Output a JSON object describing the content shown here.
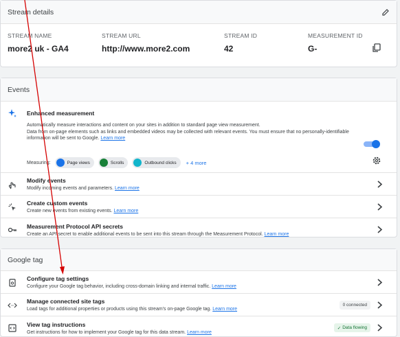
{
  "stream_details": {
    "header": "Stream details",
    "fields": [
      {
        "label": "STREAM NAME",
        "value": "more2 uk - GA4"
      },
      {
        "label": "STREAM URL",
        "value": "http://www.more2.com"
      },
      {
        "label": "STREAM ID",
        "value": "42"
      },
      {
        "label": "MEASUREMENT ID",
        "value": "G-"
      }
    ]
  },
  "events": {
    "header": "Events",
    "enhanced": {
      "title": "Enhanced measurement",
      "desc": "Automatically measure interactions and content on your sites in addition to standard page view measurement.",
      "desc2": "Data from on-page elements such as links and embedded videos may be collected with relevant events. You must ensure that no personally-identifiable information will be sent to Google.",
      "learn_more": "Learn more",
      "measuring_label": "Measuring:",
      "chips": [
        "Page views",
        "Scrolls",
        "Outbound clicks"
      ],
      "more": "+ 4 more",
      "enabled": true
    },
    "rows": [
      {
        "title": "Modify events",
        "desc": "Modify incoming events and parameters.",
        "link": "Learn more"
      },
      {
        "title": "Create custom events",
        "desc": "Create new events from existing events.",
        "link": "Learn more"
      },
      {
        "title": "Measurement Protocol API secrets",
        "desc": "Create an API secret to enable additional events to be sent into this stream through the Measurement Protocol.",
        "link": "Learn more"
      }
    ]
  },
  "google_tag": {
    "header": "Google tag",
    "rows": [
      {
        "title": "Configure tag settings",
        "desc": "Configure your Google tag behavior, including cross-domain linking and internal traffic.",
        "link": "Learn more"
      },
      {
        "title": "Manage connected site tags",
        "desc": "Load tags for additional properties or products using this stream's on-page Google tag.",
        "link": "Learn more",
        "badge": "0 connected"
      },
      {
        "title": "View tag instructions",
        "desc": "Get instructions for how to implement your Google tag for this data stream.",
        "link": "Learn more",
        "badge": "Data flowing"
      }
    ]
  },
  "colors": {
    "accent": "#1a73e8",
    "annotation": "#d50000",
    "success": "#137333"
  }
}
